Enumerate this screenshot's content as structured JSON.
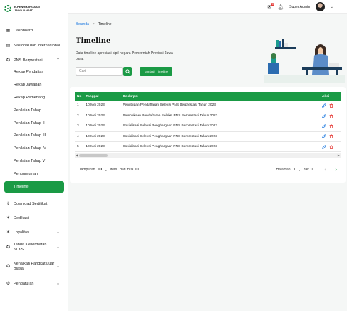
{
  "brand": {
    "line1": "E-PENGHARGAAN",
    "line2": "JAWA BARAT"
  },
  "sidebar": {
    "items": [
      {
        "label": "Dashboard",
        "icon": "dashboard-icon"
      },
      {
        "label": "Nasional dan Internasional",
        "icon": "book-icon"
      },
      {
        "label": "PNS Berprestasi",
        "icon": "award-icon"
      },
      {
        "label": "Rekap Pendaftar"
      },
      {
        "label": "Rekap Jawaban"
      },
      {
        "label": "Rekap Pemenang"
      },
      {
        "label": "Penilaian Tahap I"
      },
      {
        "label": "Penilaian Tahap II"
      },
      {
        "label": "Penilaian Tahap III"
      },
      {
        "label": "Penilaian Tahap IV"
      },
      {
        "label": "Penilaian Tahap V"
      },
      {
        "label": "Pengumuman"
      },
      {
        "label": "Timeline"
      },
      {
        "label": "Download Sertifikat",
        "icon": "download-icon"
      },
      {
        "label": "Dedikasi",
        "icon": "star-icon"
      },
      {
        "label": "Loyalitas",
        "icon": "star-icon"
      },
      {
        "label": "Tanda Kehormatan SLKS",
        "icon": "medal-icon"
      },
      {
        "label": "Kenaikan Pangkat Luar Biasa",
        "icon": "medal-icon"
      },
      {
        "label": "Pengaturan",
        "icon": "gear-icon"
      }
    ]
  },
  "topbar": {
    "mail_count": "0",
    "user_name": "Super Admin"
  },
  "breadcrumb": {
    "home": "Beranda",
    "sep": ">",
    "current": "Timeline"
  },
  "hero": {
    "title": "Timeline",
    "description": "Data timeline apresiasi sipil negara Pemerintah Provinsi Jawa barat",
    "search_placeholder": "Cari",
    "add_button": "Tambah Timeline"
  },
  "table": {
    "headers": [
      "No",
      "Tanggal",
      "Deskripsi",
      "Aksi"
    ],
    "rows": [
      {
        "no": "1",
        "tanggal": "10 Mei 2023",
        "deskripsi": "Penutupan Pendaftaran Seleksi PNS Berprestasi Tahun 2023"
      },
      {
        "no": "2",
        "tanggal": "10 Mei 2023",
        "deskripsi": "Pembukaan Pendaftaran Seleksi PNS Berprestasi Tahun 2023"
      },
      {
        "no": "3",
        "tanggal": "10 Mei 2023",
        "deskripsi": "Sosialisasi Seleksi Penghargaan PNS Berprestasi Tahun 2023"
      },
      {
        "no": "4",
        "tanggal": "10 Mei 2023",
        "deskripsi": "Sosialisasi Seleksi Penghargaan PNS Berprestasi Tahun 2023"
      },
      {
        "no": "5",
        "tanggal": "10 Mei 2023",
        "deskripsi": "Sosialisasi Seleksi Penghargaan PNS Berprestasi Tahun 2023"
      }
    ]
  },
  "pager": {
    "show_label": "Tampilkan",
    "per_page": "10",
    "items_label": "Item",
    "total_label": "dari total 100",
    "page_label": "Halaman",
    "page": "1",
    "of_label": "dari 10"
  },
  "colors": {
    "primary": "#1a9a45",
    "link": "#1f7ae0",
    "danger": "#e53935"
  }
}
